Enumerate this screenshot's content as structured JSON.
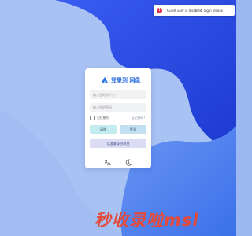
{
  "toast": {
    "icon": "error-icon",
    "message": "Guest user is disabled, login please"
  },
  "app": {
    "brand": "登录到 网盘"
  },
  "form": {
    "username_placeholder": "输入您的用户名",
    "password_placeholder": "输入您的密码",
    "remember_label": "记住账号",
    "forgot_label": "忘记密码？",
    "reset_label": "清除",
    "login_label": "登录",
    "guest_label": "以游客身份浏览"
  },
  "watermark": {
    "text": "秒收录啦msl"
  },
  "colors": {
    "background": "#9bb8f2",
    "accent_blue": "#2a6fe0",
    "blob_light": "#5a87f0",
    "blob_dark": "#1f44d8",
    "error": "#d9314b"
  }
}
